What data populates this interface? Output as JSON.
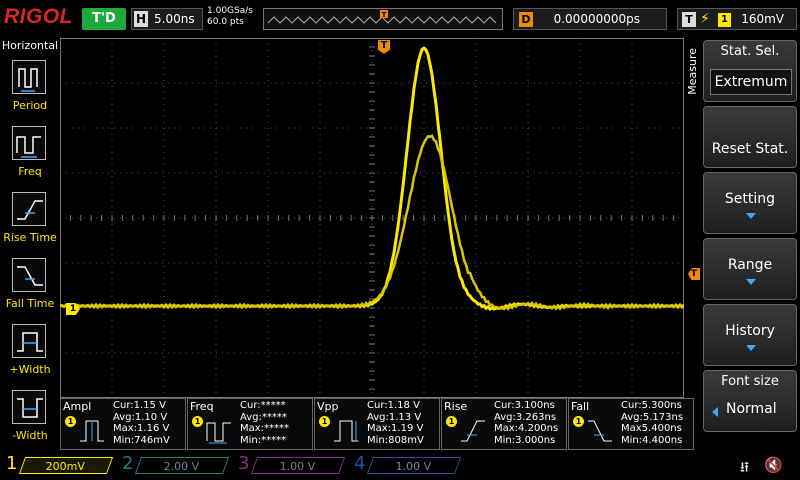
{
  "brand": "RIGOL",
  "header": {
    "trigger_status": "T'D",
    "timebase_label": "H",
    "timebase_value": "5.00ns",
    "sample_rate": "1.00GSa/s",
    "points": "60.0 pts",
    "delay_label": "D",
    "delay_value": "0.00000000ps",
    "trigger_label": "T",
    "trigger_edge": "rising-edge-icon",
    "trigger_source": "1",
    "trigger_level": "160mV"
  },
  "left_menu": {
    "title": "Horizontal",
    "items": [
      {
        "label": "Period",
        "icon": "period-icon"
      },
      {
        "label": "Freq",
        "icon": "freq-icon"
      },
      {
        "label": "Rise Time",
        "icon": "rise-time-icon"
      },
      {
        "label": "Fall Time",
        "icon": "fall-time-icon"
      },
      {
        "label": "+Width",
        "icon": "positive-width-icon"
      },
      {
        "label": "-Width",
        "icon": "negative-width-icon"
      }
    ]
  },
  "right_menu": {
    "side_label": "Measure",
    "stat_sel_label": "Stat. Sel.",
    "stat_sel_value": "Extremum",
    "reset_stat": "Reset Stat.",
    "setting": "Setting",
    "range": "Range",
    "history": "History",
    "font_size_label": "Font size",
    "font_size_value": "Normal"
  },
  "markers": {
    "trigger_pos": "T",
    "ch1_ground": "1",
    "trig_level": "T"
  },
  "measurements": [
    {
      "name": "Ampl",
      "channel": "1",
      "cur": "Cur:1.15 V",
      "avg": "Avg:1.10 V",
      "max": "Max:1.16 V",
      "min": "Min:746mV"
    },
    {
      "name": "Freq",
      "channel": "1",
      "cur": "Cur:*****",
      "avg": "Avg:*****",
      "max": "Max:*****",
      "min": "Min:*****"
    },
    {
      "name": "Vpp",
      "channel": "1",
      "cur": "Cur:1.18 V",
      "avg": "Avg:1.13 V",
      "max": "Max:1.19 V",
      "min": "Min:808mV"
    },
    {
      "name": "Rise",
      "channel": "1",
      "cur": "Cur:3.100ns",
      "avg": "Avg:3.263ns",
      "max": "Max:4.200ns",
      "min": "Min:3.000ns"
    },
    {
      "name": "Fall",
      "channel": "1",
      "cur": "Cur:5.300ns",
      "avg": "Avg:5.173ns",
      "max": "Max5.400ns",
      "min": "Min:4.400ns"
    }
  ],
  "channels": [
    {
      "num": "1",
      "scale": "200mV",
      "color": "#ffe800"
    },
    {
      "num": "2",
      "scale": "2.00 V",
      "color": "#1e7f8a"
    },
    {
      "num": "3",
      "scale": "1.00 V",
      "color": "#8a2a8a"
    },
    {
      "num": "4",
      "scale": "1.00 V",
      "color": "#2a4fa0"
    }
  ],
  "colors": {
    "ch1": "#ffe800",
    "accent_blue": "#3aa9ff",
    "trigger_orange": "#f08a00",
    "brand_red": "#d7262a"
  }
}
